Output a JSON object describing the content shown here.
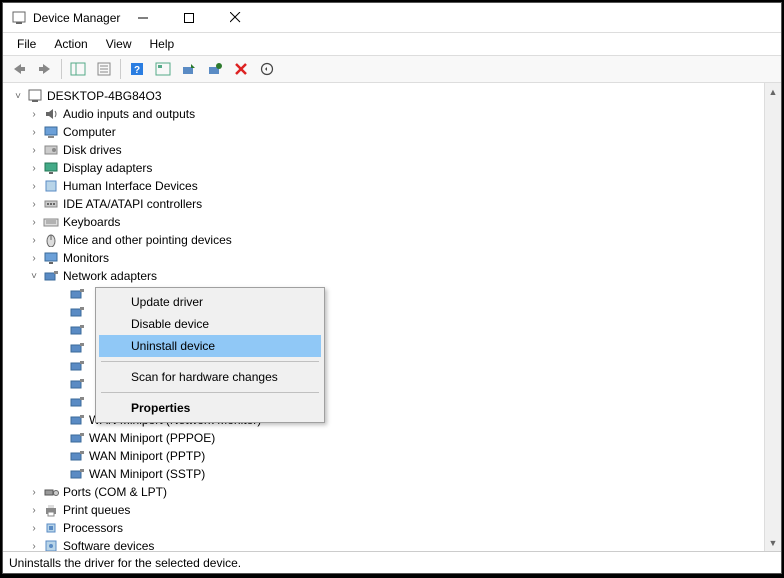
{
  "title": "Device Manager",
  "menubar": [
    "File",
    "Action",
    "View",
    "Help"
  ],
  "root_node": "DESKTOP-4BG84O3",
  "categories": [
    {
      "label": "Audio inputs and outputs",
      "expanded": false,
      "icon": "audio"
    },
    {
      "label": "Computer",
      "expanded": false,
      "icon": "computer"
    },
    {
      "label": "Disk drives",
      "expanded": false,
      "icon": "disk"
    },
    {
      "label": "Display adapters",
      "expanded": false,
      "icon": "display"
    },
    {
      "label": "Human Interface Devices",
      "expanded": false,
      "icon": "hid"
    },
    {
      "label": "IDE ATA/ATAPI controllers",
      "expanded": false,
      "icon": "ide"
    },
    {
      "label": "Keyboards",
      "expanded": false,
      "icon": "keyboard"
    },
    {
      "label": "Mice and other pointing devices",
      "expanded": false,
      "icon": "mouse"
    },
    {
      "label": "Monitors",
      "expanded": false,
      "icon": "monitor"
    },
    {
      "label": "Network adapters",
      "expanded": true,
      "icon": "network",
      "children": [
        {
          "label": "",
          "icon": "network"
        },
        {
          "label": "",
          "icon": "network"
        },
        {
          "label": "",
          "icon": "network"
        },
        {
          "label": "",
          "icon": "network"
        },
        {
          "label": "",
          "icon": "network"
        },
        {
          "label": "",
          "icon": "network"
        },
        {
          "label": "",
          "icon": "network"
        },
        {
          "label": "WAN Miniport (Network Monitor)",
          "icon": "network"
        },
        {
          "label": "WAN Miniport (PPPOE)",
          "icon": "network"
        },
        {
          "label": "WAN Miniport (PPTP)",
          "icon": "network"
        },
        {
          "label": "WAN Miniport (SSTP)",
          "icon": "network"
        }
      ]
    },
    {
      "label": "Ports (COM & LPT)",
      "expanded": false,
      "icon": "ports"
    },
    {
      "label": "Print queues",
      "expanded": false,
      "icon": "print"
    },
    {
      "label": "Processors",
      "expanded": false,
      "icon": "cpu"
    },
    {
      "label": "Software devices",
      "expanded": false,
      "icon": "software"
    }
  ],
  "context_menu": {
    "items": [
      {
        "label": "Update driver",
        "type": "item"
      },
      {
        "label": "Disable device",
        "type": "item"
      },
      {
        "label": "Uninstall device",
        "type": "item",
        "highlighted": true,
        "redbox": true
      },
      {
        "type": "sep"
      },
      {
        "label": "Scan for hardware changes",
        "type": "item"
      },
      {
        "type": "sep"
      },
      {
        "label": "Properties",
        "type": "item",
        "bold": true
      }
    ]
  },
  "statusbar": "Uninstalls the driver for the selected device."
}
